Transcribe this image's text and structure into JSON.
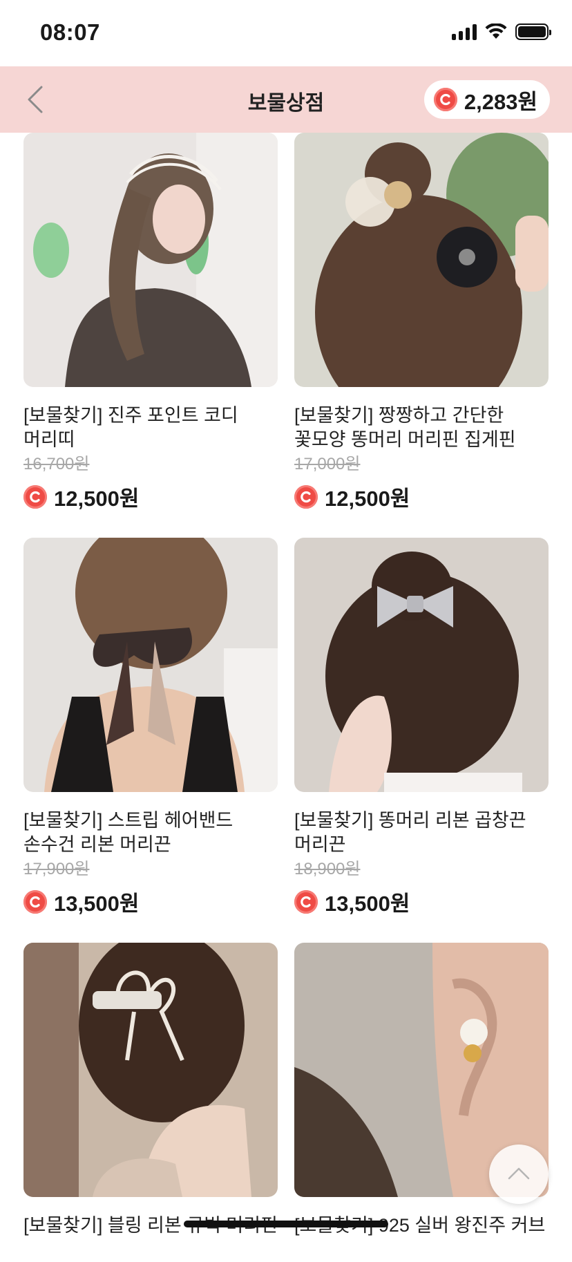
{
  "status": {
    "time": "08:07"
  },
  "header": {
    "title": "보물상점",
    "points": "2,283원"
  },
  "products": [
    {
      "name": "[보물찾기] 진주 포인트 코디 머리띠",
      "original_price": "16,700원",
      "sale_price": "12,500원",
      "image_icon": "pearl-headband-photo"
    },
    {
      "name": "[보물찾기] 짱짱하고 간단한 꽃모양 똥머리 머리핀 집게핀",
      "original_price": "17,000원",
      "sale_price": "12,500원",
      "image_icon": "flower-hair-clip-photo"
    },
    {
      "name": "[보물찾기] 스트립 헤어밴드 손수건 리본 머리끈",
      "original_price": "17,900원",
      "sale_price": "13,500원",
      "image_icon": "ribbon-scarf-photo"
    },
    {
      "name": "[보물찾기] 똥머리 리본 곱창끈 머리끈",
      "original_price": "18,900원",
      "sale_price": "13,500원",
      "image_icon": "glitter-bow-photo"
    },
    {
      "name": "[보물찾기] 블링 리본 큐빅 머리핀",
      "original_price": "",
      "sale_price": "",
      "image_icon": "bow-claw-clip-photo"
    },
    {
      "name": "[보물찾기] 925 실버 왕진주 커브",
      "original_price": "",
      "sale_price": "",
      "image_icon": "pearl-earring-photo"
    }
  ],
  "colors": {
    "header_bg": "#f6d6d4",
    "coin": "#ef4b45",
    "strike_price": "#a7a7a7"
  }
}
